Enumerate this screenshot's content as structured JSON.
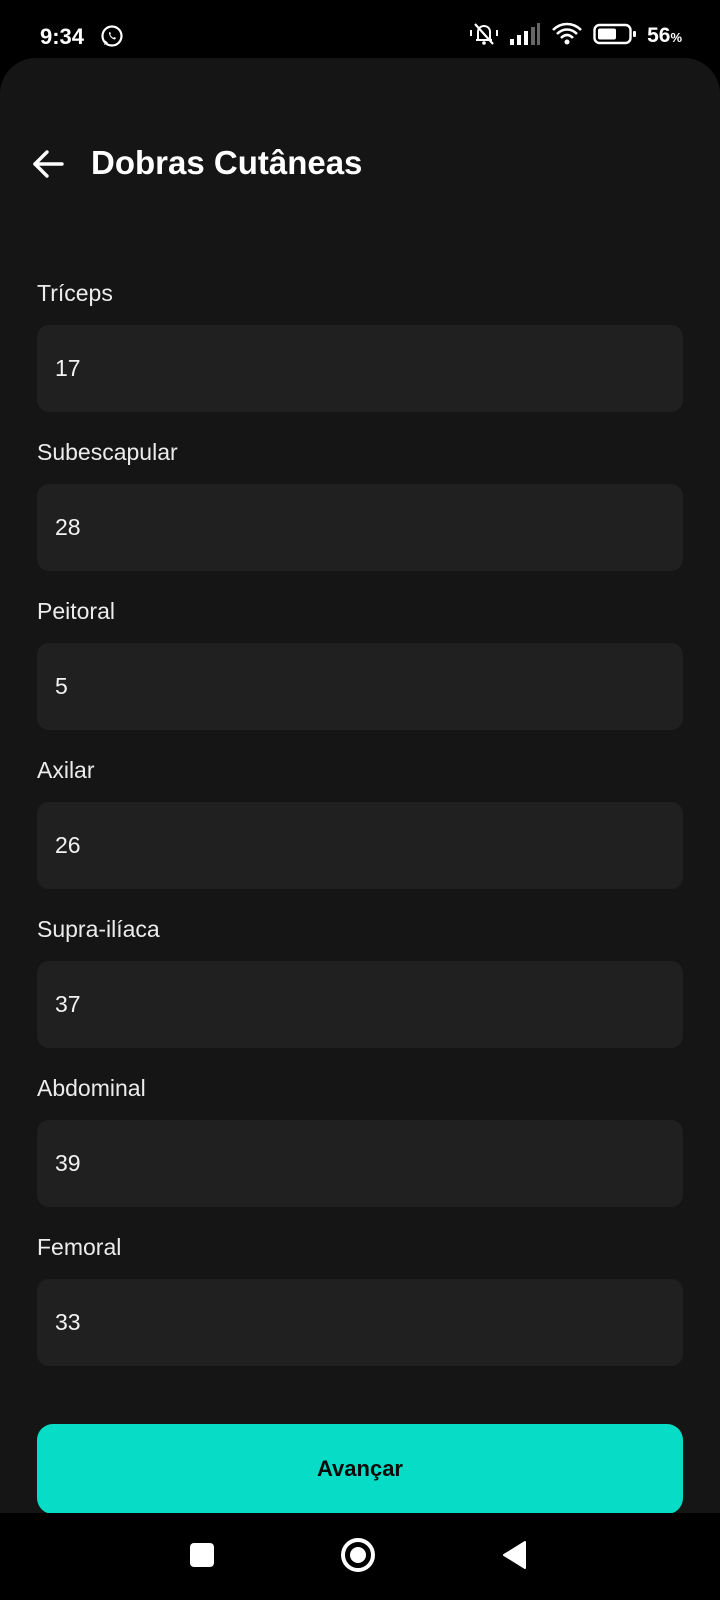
{
  "status": {
    "time": "9:34",
    "battery": "56",
    "battery_unit": "%",
    "icons": [
      "whatsapp-icon",
      "mute-icon",
      "signal-icon",
      "wifi-icon",
      "battery-icon"
    ]
  },
  "header": {
    "title": "Dobras Cutâneas",
    "back_icon": "arrow-left-icon"
  },
  "fields": [
    {
      "label": "Tríceps",
      "value": "17"
    },
    {
      "label": "Subescapular",
      "value": "28"
    },
    {
      "label": "Peitoral",
      "value": "5"
    },
    {
      "label": "Axilar",
      "value": "26"
    },
    {
      "label": "Supra-ilíaca",
      "value": "37"
    },
    {
      "label": "Abdominal",
      "value": "39"
    },
    {
      "label": "Femoral",
      "value": "33"
    }
  ],
  "actions": {
    "advance_label": "Avançar"
  },
  "colors": {
    "background": "#151515",
    "input_bg": "#202020",
    "accent": "#06dcc6"
  },
  "navbar": {
    "icons": [
      "recents-square-icon",
      "home-circle-icon",
      "back-triangle-icon"
    ]
  }
}
